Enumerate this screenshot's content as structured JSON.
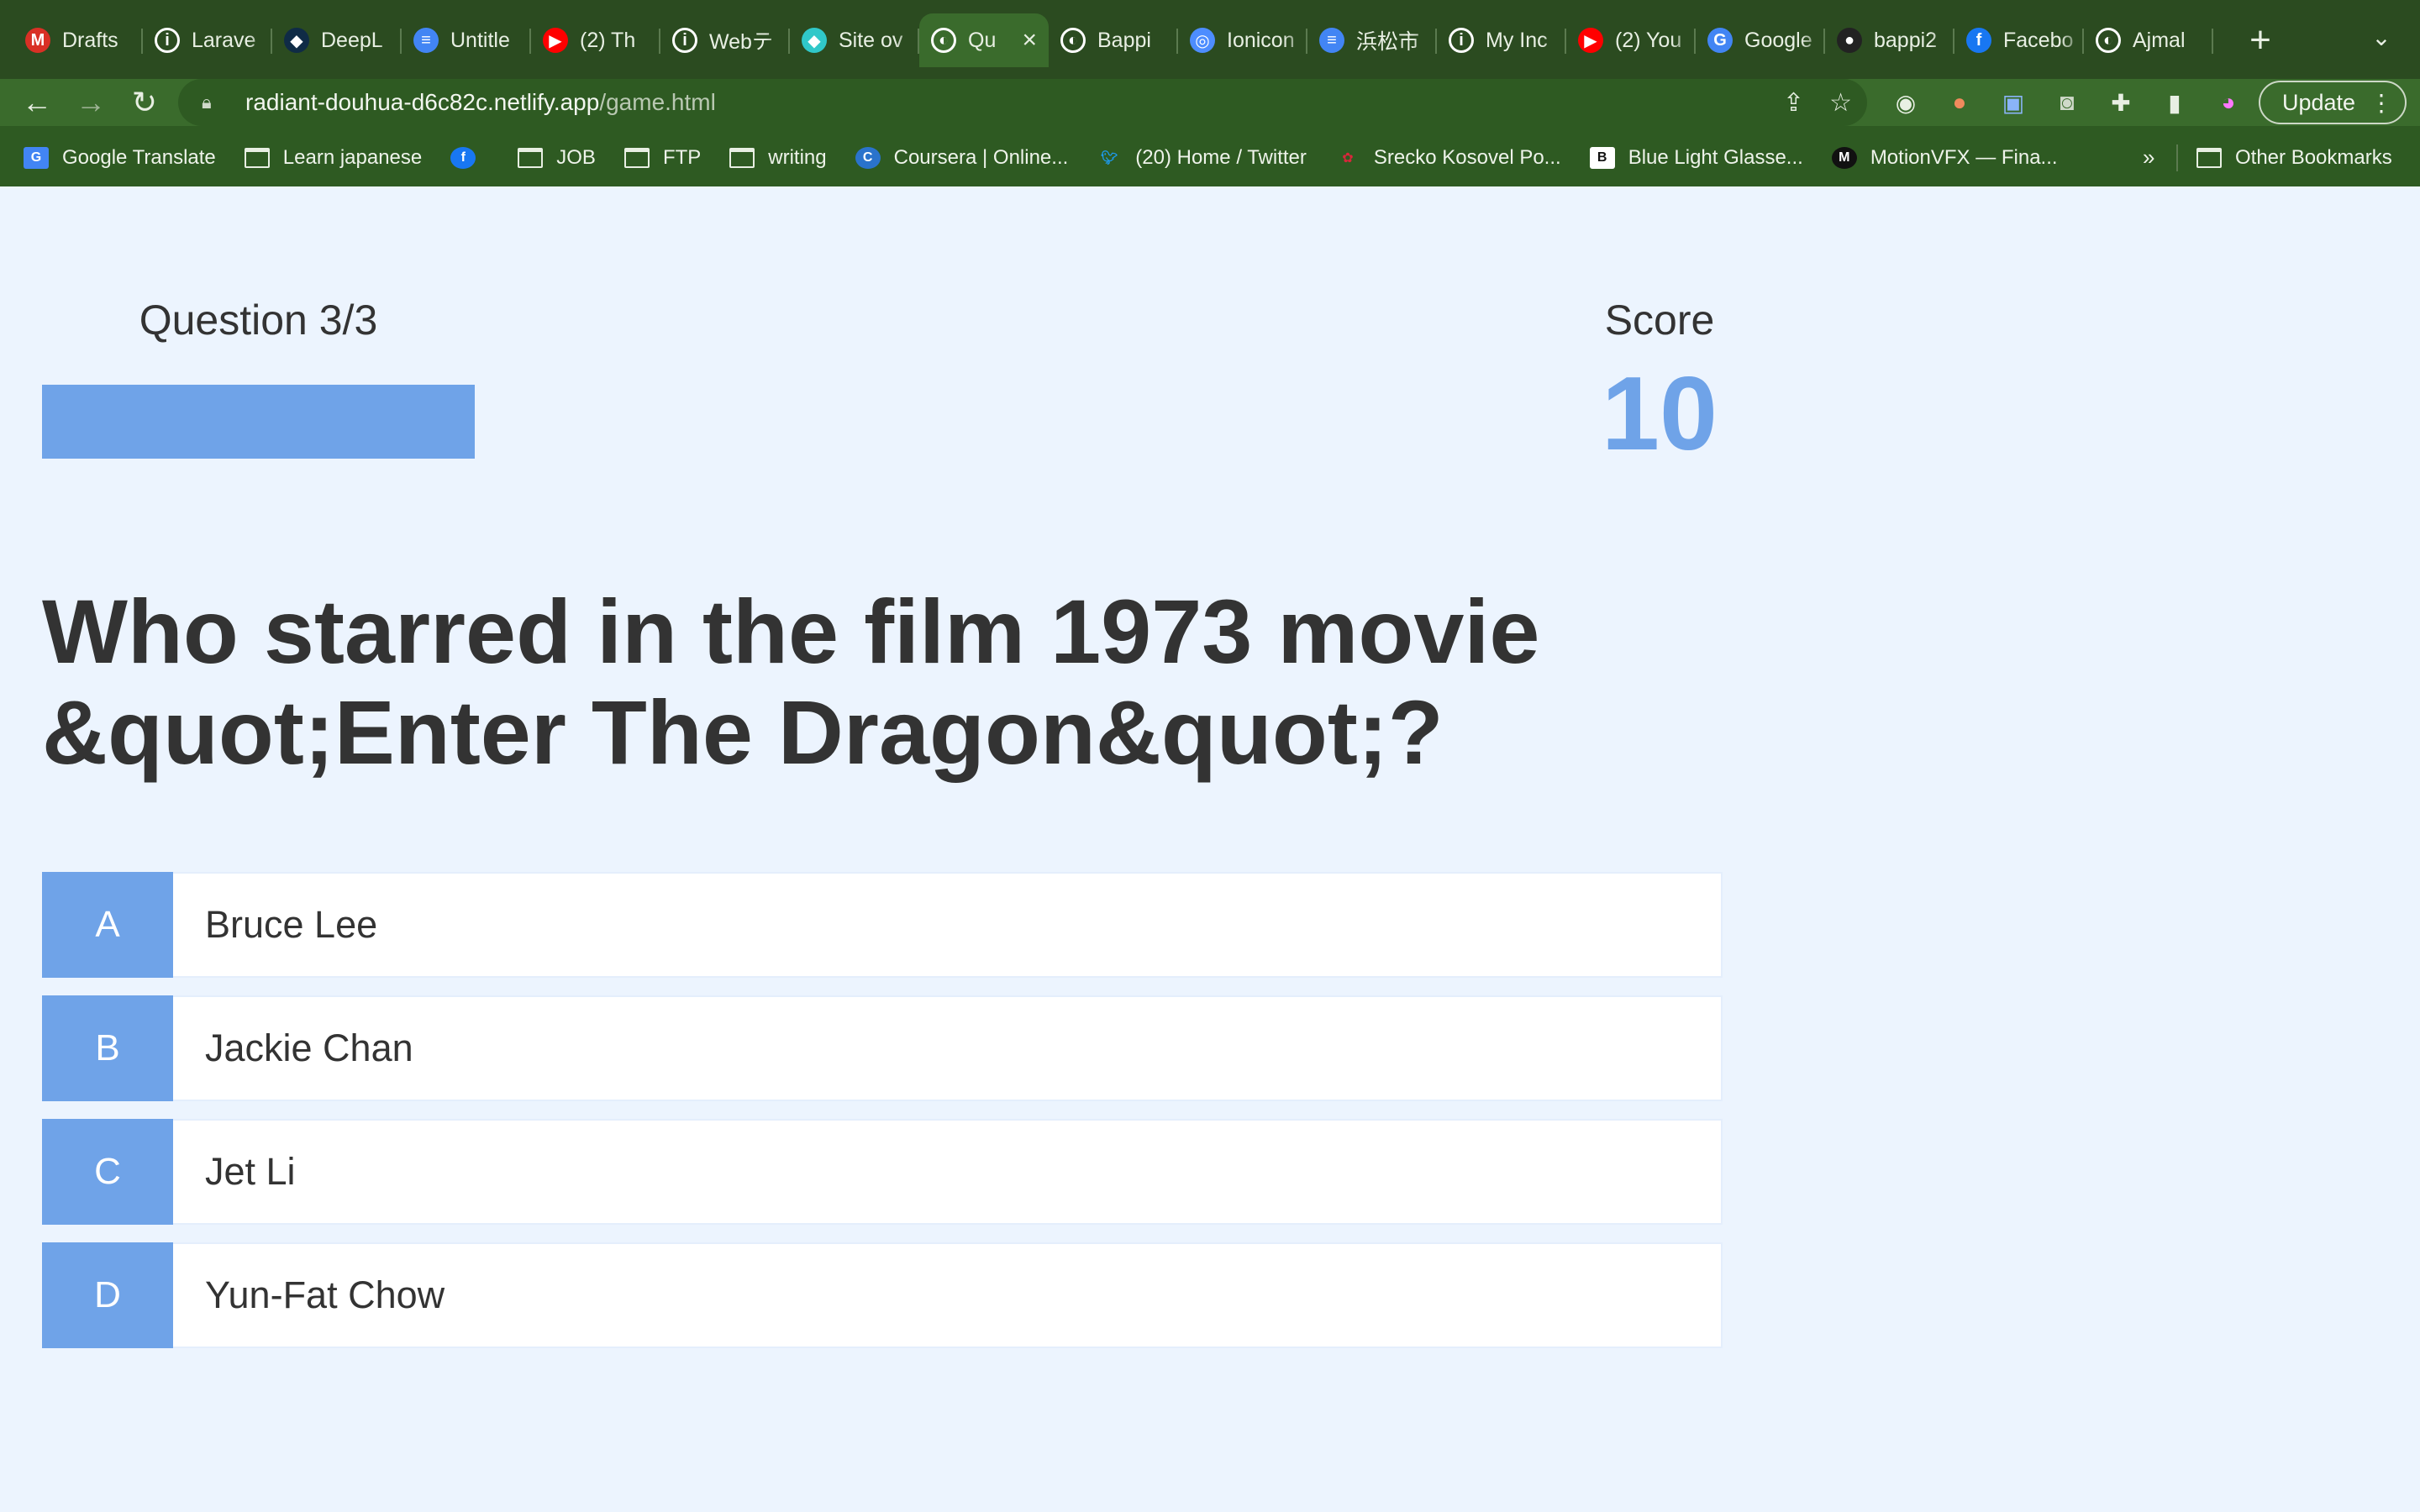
{
  "browser": {
    "tabs": [
      {
        "title": "Drafts",
        "icon": "gmail-icon",
        "color": "#d93025",
        "glyph": "M"
      },
      {
        "title": "Larave",
        "icon": "info-icon",
        "color": "#ffffff",
        "glyph": "i"
      },
      {
        "title": "DeepL",
        "icon": "deepl-icon",
        "color": "#0f2b46",
        "glyph": "◆"
      },
      {
        "title": "Untitle",
        "icon": "docs-icon",
        "color": "#4285f4",
        "glyph": "≡"
      },
      {
        "title": "(2) Th",
        "icon": "youtube-icon",
        "color": "#ff0000",
        "glyph": "▶"
      },
      {
        "title": "Webテ",
        "icon": "info-icon",
        "color": "#ffffff",
        "glyph": "i"
      },
      {
        "title": "Site ov",
        "icon": "netlify-icon",
        "color": "#30c8c9",
        "glyph": "◆"
      },
      {
        "title": "Qu",
        "icon": "globe-icon",
        "color": "#ffffff",
        "glyph": "◐",
        "active": true
      },
      {
        "title": "Bappi",
        "icon": "globe-icon",
        "color": "#ffffff",
        "glyph": "◐"
      },
      {
        "title": "Ionicon",
        "icon": "ionicons-icon",
        "color": "#4d8dff",
        "glyph": "◎"
      },
      {
        "title": "浜松市",
        "icon": "docs-icon",
        "color": "#4285f4",
        "glyph": "≡"
      },
      {
        "title": "My Inc",
        "icon": "info-icon",
        "color": "#ffffff",
        "glyph": "i"
      },
      {
        "title": "(2) You",
        "icon": "youtube-icon",
        "color": "#ff0000",
        "glyph": "▶"
      },
      {
        "title": "Google",
        "icon": "google-translate-icon",
        "color": "#4285f4",
        "glyph": "G"
      },
      {
        "title": "bappi2",
        "icon": "github-icon",
        "color": "#222222",
        "glyph": "●"
      },
      {
        "title": "Facebo",
        "icon": "facebook-icon",
        "color": "#1877f2",
        "glyph": "f"
      },
      {
        "title": "Ajmal",
        "icon": "globe-icon",
        "color": "#ffffff",
        "glyph": "◐"
      }
    ],
    "url_host": "radiant-douhua-d6c82c.netlify.app",
    "url_path": "/game.html",
    "update_label": "Update",
    "bookmarks": [
      {
        "label": "Google Translate",
        "icon": "google-translate-icon"
      },
      {
        "label": "Learn japanese",
        "icon": "folder-icon"
      },
      {
        "label": "",
        "icon": "facebook-icon"
      },
      {
        "label": "JOB",
        "icon": "folder-icon"
      },
      {
        "label": "FTP",
        "icon": "folder-icon"
      },
      {
        "label": "writing",
        "icon": "folder-icon"
      },
      {
        "label": "Coursera | Online...",
        "icon": "coursera-icon"
      },
      {
        "label": "(20) Home / Twitter",
        "icon": "twitter-icon"
      },
      {
        "label": "Srecko Kosovel Po...",
        "icon": "rose-icon"
      },
      {
        "label": "Blue Light Glasse...",
        "icon": "b-logo-icon"
      },
      {
        "label": "MotionVFX — Fina...",
        "icon": "motionvfx-icon"
      }
    ],
    "other_bookmarks": "Other Bookmarks"
  },
  "game": {
    "question_counter": "Question 3/3",
    "progress": 1.0,
    "score_label": "Score",
    "score": "10",
    "question": "Who starred in the film 1973 movie &quot;Enter The Dragon&quot;?",
    "choices": [
      {
        "prefix": "A",
        "text": "Bruce Lee"
      },
      {
        "prefix": "B",
        "text": "Jackie Chan"
      },
      {
        "prefix": "C",
        "text": "Jet Li"
      },
      {
        "prefix": "D",
        "text": "Yun-Fat Chow"
      }
    ]
  },
  "colors": {
    "accent": "#6fa3e8",
    "page_bg": "#ecf4fe",
    "chrome": "#2e5a22"
  }
}
